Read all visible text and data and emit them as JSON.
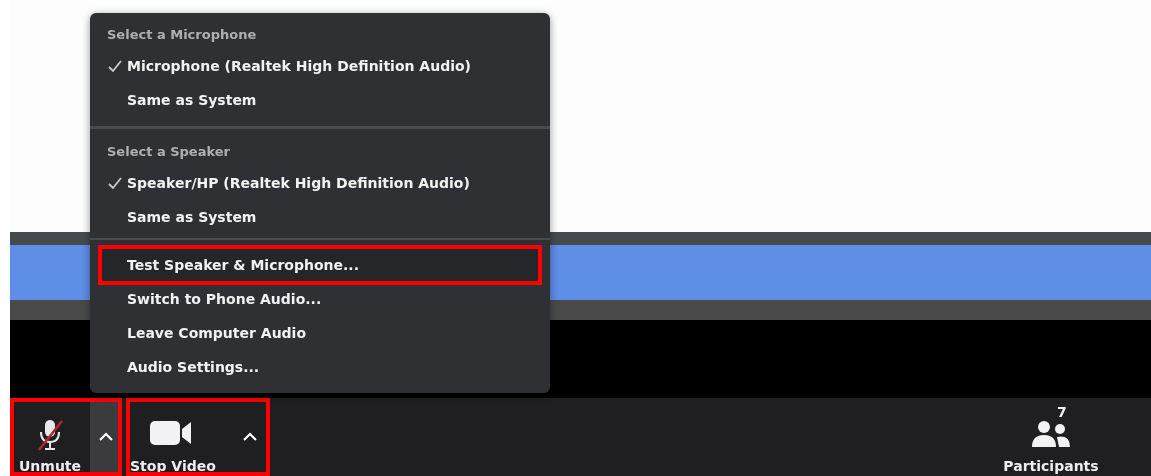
{
  "audio_menu": {
    "sections": [
      {
        "header": "Select a Microphone",
        "items": [
          {
            "label": "Microphone (Realtek High Definition Audio)",
            "checked": true
          },
          {
            "label": "Same as System",
            "checked": false
          }
        ]
      },
      {
        "header": "Select a Speaker",
        "items": [
          {
            "label": "Speaker/HP (Realtek High Definition Audio)",
            "checked": true
          },
          {
            "label": "Same as System",
            "checked": false
          }
        ]
      }
    ],
    "actions": [
      {
        "label": "Test Speaker & Microphone...",
        "highlighted": true
      },
      {
        "label": "Switch to Phone Audio...",
        "highlighted": false
      },
      {
        "label": "Leave Computer Audio",
        "highlighted": false
      },
      {
        "label": "Audio Settings...",
        "highlighted": false
      }
    ]
  },
  "toolbar": {
    "audio": {
      "label": "Unmute",
      "muted": true,
      "highlighted": true
    },
    "video": {
      "label": "Stop Video",
      "highlighted": true
    },
    "participants": {
      "label": "Participants",
      "count": "7"
    }
  }
}
